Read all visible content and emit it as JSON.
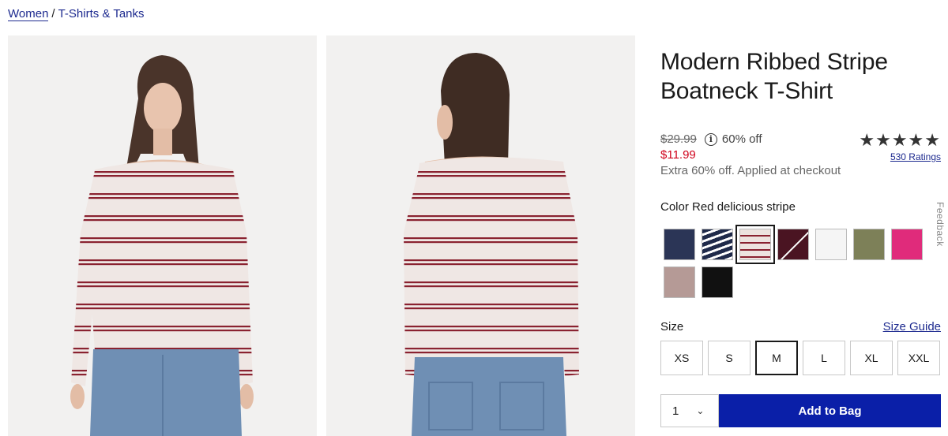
{
  "breadcrumb": {
    "items": [
      {
        "label": "Women"
      },
      {
        "label": "T-Shirts & Tanks"
      }
    ],
    "separator": "/"
  },
  "product": {
    "title": "Modern Ribbed Stripe Boatneck T-Shirt",
    "original_price": "$29.99",
    "discount": "60% off",
    "sale_price": "$11.99",
    "promo_text": "Extra 60% off. Applied at checkout",
    "rating": {
      "stars": "★★★★★",
      "value": 5,
      "ratings_link": "530 Ratings"
    }
  },
  "color": {
    "label": "Color Red delicious stripe",
    "swatches": [
      {
        "name": "navy",
        "color": "#2b3556",
        "selected": false
      },
      {
        "name": "navy-stripe",
        "color": "#1f2a4a",
        "selected": false
      },
      {
        "name": "red-delicious-stripe",
        "color": "#8a2230",
        "selected": true
      },
      {
        "name": "burgundy",
        "color": "#4a1422",
        "selected": false,
        "unavailable": true
      },
      {
        "name": "white",
        "color": "#f5f5f5",
        "selected": false
      },
      {
        "name": "olive",
        "color": "#7d8058",
        "selected": false
      },
      {
        "name": "pink",
        "color": "#e02b7b",
        "selected": false
      },
      {
        "name": "mauve",
        "color": "#b59a96",
        "selected": false
      },
      {
        "name": "black",
        "color": "#111111",
        "selected": false
      }
    ]
  },
  "size": {
    "label": "Size",
    "guide_link": "Size Guide",
    "options": [
      "XS",
      "S",
      "M",
      "L",
      "XL",
      "XXL"
    ],
    "selected": "M"
  },
  "cart": {
    "quantity": "1",
    "add_label": "Add to Bag"
  },
  "feedback": {
    "label": "Feedback"
  },
  "colors": {
    "link": "#1d2a8f",
    "sale": "#d0021b",
    "primary_button": "#0a1fa8",
    "photo_background": "#f2f1f0",
    "stripe": "#8a2230"
  }
}
